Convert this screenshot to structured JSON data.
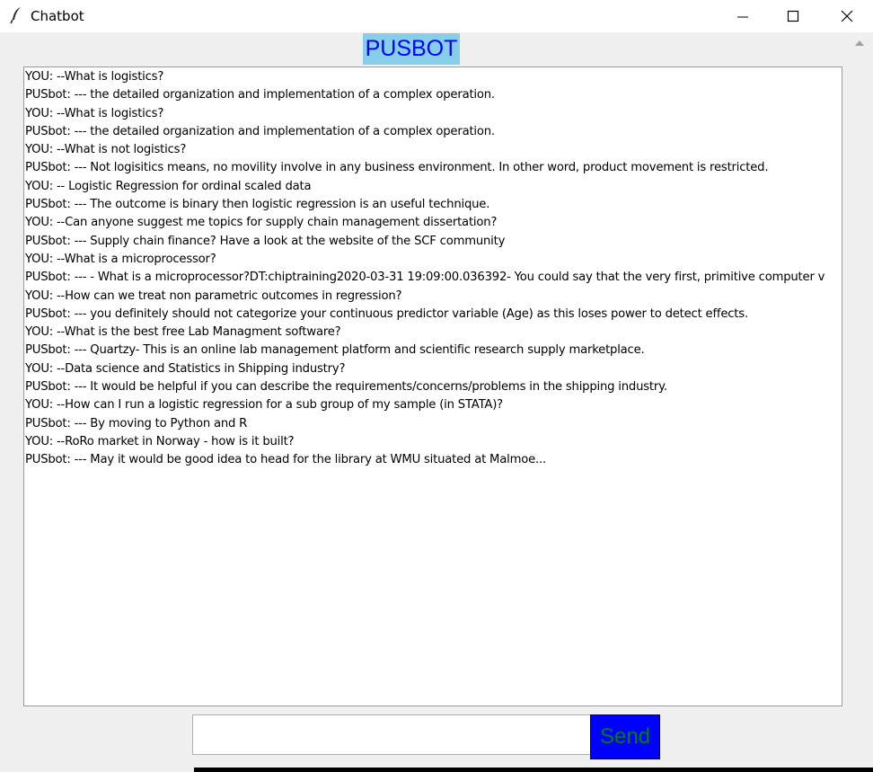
{
  "window": {
    "title": "Chatbot",
    "icon": "feather-icon",
    "controls": [
      "minimize-icon",
      "maximize-icon",
      "close-icon"
    ]
  },
  "header": {
    "bot_name": "PUSBOT",
    "bg_color": "#87ceeb",
    "text_color": "#0000ff"
  },
  "chat": {
    "lines": [
      "YOU: --What is logistics?",
      "PUSbot: --- the detailed organization and implementation of a complex operation.",
      "YOU: --What is logistics?",
      "PUSbot: --- the detailed organization and implementation of a complex operation.",
      "YOU: --What is not logistics?",
      "PUSbot: --- Not logisitics means, no movility involve in any business environment. In other word, product movement is restricted.",
      "YOU: -- Logistic Regression for ordinal scaled data",
      "PUSbot: --- The outcome is binary then logistic regression is an useful technique.",
      "YOU: --Can anyone suggest me topics for supply chain management dissertation?",
      "PUSbot: --- Supply chain finance? Have a look at the website of the SCF community",
      "YOU: --What is a microprocessor?",
      "PUSbot: --- - What is a microprocessor?DT:chiptraining2020-03-31 19:09:00.036392- You could say that the very first, primitive computer v",
      "YOU: --How can we treat non parametric outcomes in regression?",
      "PUSbot: --- you definitely should not categorize your continuous predictor variable (Age) as this loses power to detect effects.",
      "YOU: --What is the best free Lab Managment software?",
      "PUSbot: --- Quartzy- This is an online lab management platform and scientific research supply marketplace.",
      "YOU: --Data science and Statistics in Shipping industry?",
      "PUSbot: --- It would be helpful if you can describe the requirements/concerns/problems in the shipping industry.",
      "YOU: --How can I run a logistic regression for a sub group of my sample (in STATA)?",
      "PUSbot: --- By moving to Python and R",
      "YOU: --RoRo market in Norway - how is it built?",
      "PUSbot: --- May it would be good idea to head for the library at WMU situated at Malmoe..."
    ]
  },
  "input": {
    "value": "",
    "placeholder": ""
  },
  "send": {
    "label": "Send",
    "bg_color": "#0000ff",
    "text_color": "#008000"
  }
}
